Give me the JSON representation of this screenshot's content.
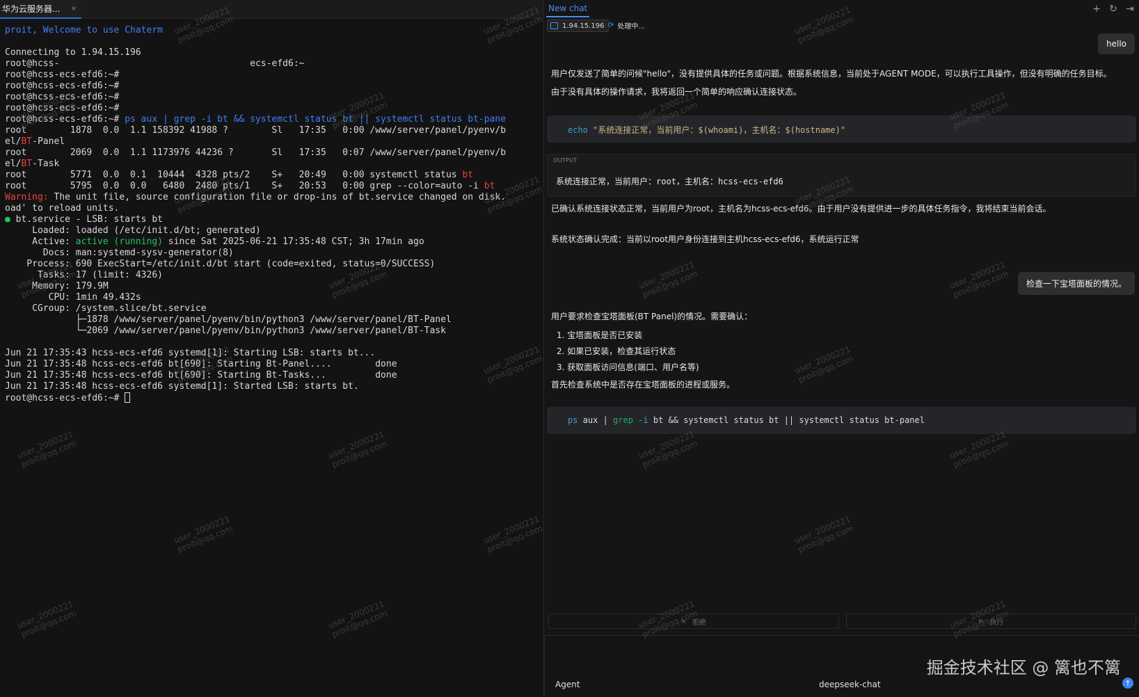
{
  "terminal_tab": {
    "title": "华为云服务器...",
    "close": "×"
  },
  "terminal_lines": [
    [
      {
        "t": "proit, Welcome to use Chaterm",
        "c": "blue"
      }
    ],
    [
      {
        "t": ""
      }
    ],
    [
      {
        "t": "Connecting to 1.94.15.196"
      }
    ],
    [
      {
        "t": "root@hcss-                                   ecs-efd6:~"
      }
    ],
    [
      {
        "t": "root@hcss-ecs-efd6:~#"
      }
    ],
    [
      {
        "t": "root@hcss-ecs-efd6:~#"
      }
    ],
    [
      {
        "t": "root@hcss-ecs-efd6:~#"
      }
    ],
    [
      {
        "t": "root@hcss-ecs-efd6:~#"
      }
    ],
    [
      {
        "t": "root@hcss-ecs-efd6:~# "
      },
      {
        "t": "ps aux | grep -i bt && systemctl status bt || systemctl status bt-pane",
        "c": "blue"
      }
    ],
    [
      {
        "t": "root        1878  0.0  1.1 158392 41988 ?        Sl   17:35   0:00 /www/server/panel/pyenv/b"
      }
    ],
    [
      {
        "t": "el/"
      },
      {
        "t": "BT",
        "c": "red"
      },
      {
        "t": "-Panel"
      }
    ],
    [
      {
        "t": "root        2069  0.0  1.1 1173976 44236 ?       Sl   17:35   0:07 /www/server/panel/pyenv/b"
      }
    ],
    [
      {
        "t": "el/"
      },
      {
        "t": "BT",
        "c": "red"
      },
      {
        "t": "-Task"
      }
    ],
    [
      {
        "t": "root        5771  0.0  0.1  10444  4328 pts/2    S+   20:49   0:00 systemctl status "
      },
      {
        "t": "bt",
        "c": "red"
      }
    ],
    [
      {
        "t": "root        5795  0.0  0.0   6480  2480 pts/1    S+   20:53   0:00 grep --color=auto -i "
      },
      {
        "t": "bt",
        "c": "red"
      }
    ],
    [
      {
        "t": "Warning:",
        "c": "red"
      },
      {
        "t": " The unit file, source configuration file or drop-ins of bt.service changed on disk."
      }
    ],
    [
      {
        "t": "oad' to reload units."
      }
    ],
    [
      {
        "t": "●",
        "c": "green"
      },
      {
        "t": " bt.service - LSB: starts bt"
      }
    ],
    [
      {
        "t": "     Loaded: loaded (/etc/init.d/bt; generated)"
      }
    ],
    [
      {
        "t": "     Active: "
      },
      {
        "t": "active (running)",
        "c": "green"
      },
      {
        "t": " since Sat 2025-06-21 17:35:48 CST; 3h 17min ago"
      }
    ],
    [
      {
        "t": "       Docs: man:systemd-sysv-generator(8)"
      }
    ],
    [
      {
        "t": "    Process: 690 ExecStart=/etc/init.d/bt start (code=exited, status=0/SUCCESS)"
      }
    ],
    [
      {
        "t": "      Tasks: 17 (limit: 4326)"
      }
    ],
    [
      {
        "t": "     Memory: 179.9M"
      }
    ],
    [
      {
        "t": "        CPU: 1min 49.432s"
      }
    ],
    [
      {
        "t": "     CGroup: /system.slice/bt.service"
      }
    ],
    [
      {
        "t": "             ├─1878 /www/server/panel/pyenv/bin/python3 /www/server/panel/BT-Panel"
      }
    ],
    [
      {
        "t": "             └─2069 /www/server/panel/pyenv/bin/python3 /www/server/panel/BT-Task"
      }
    ],
    [
      {
        "t": ""
      }
    ],
    [
      {
        "t": "Jun 21 17:35:43 hcss-ecs-efd6 systemd[1]: Starting LSB: starts bt..."
      }
    ],
    [
      {
        "t": "Jun 21 17:35:48 hcss-ecs-efd6 bt[690]: Starting Bt-Panel....        done"
      }
    ],
    [
      {
        "t": "Jun 21 17:35:48 hcss-ecs-efd6 bt[690]: Starting Bt-Tasks...         done"
      }
    ],
    [
      {
        "t": "Jun 21 17:35:48 hcss-ecs-efd6 systemd[1]: Started LSB: starts bt."
      }
    ],
    [
      {
        "t": "root@hcss-ecs-efd6:~# "
      },
      {
        "cursor": true
      }
    ]
  ],
  "chat": {
    "tab_label": "New chat",
    "top_icons": [
      "plus-icon",
      "history-icon",
      "collapse-panel-icon"
    ],
    "top_icon_glyphs": [
      "+",
      "↻",
      "⇥"
    ],
    "host_chip": "1.94.15.196",
    "processing": "处理中...",
    "user_msg_1": "hello",
    "reply_1_line_1": "用户仅发送了简单的问候\"hello\"，没有提供具体的任务或问题。根据系统信息，当前处于AGENT MODE，可以执行工具操作，但没有明确的任务目标。",
    "reply_1_line_2": "由于没有具体的操作请求，我将返回一个简单的响应确认连接状态。",
    "cmd_1": {
      "tokens": [
        {
          "t": "echo",
          "c": "cmd"
        },
        {
          "t": " "
        },
        {
          "t": "\"系统连接正常，当前用户：$(whoami)，主机名：$(hostname)\"",
          "c": "str"
        }
      ]
    },
    "output_label": "OUTPUT",
    "output_prefix": "系统连接正常，当前用户：",
    "output_user": "root",
    "output_mid": "，主机名：",
    "output_host": "hcss-ecs-efd6",
    "reply_2": "已确认系统连接状态正常，当前用户为root，主机名为hcss-ecs-efd6。由于用户没有提供进一步的具体任务指令，我将结束当前会话。",
    "reply_3": "系统状态确认完成：当前以root用户身份连接到主机hcss-ecs-efd6，系统运行正常",
    "user_msg_2": "检查一下宝塔面板的情况。",
    "reply_4_intro": "用户要求检查宝塔面板(BT Panel)的情况。需要确认：",
    "reply_4_steps": [
      "1. 宝塔面板是否已安装",
      "2. 如果已安装，检查其运行状态",
      "3. 获取面板访问信息(端口、用户名等)"
    ],
    "reply_4_outro": "首先检查系统中是否存在宝塔面板的进程或服务。",
    "cmd_2": {
      "tokens": [
        {
          "t": "ps",
          "c": "cmd"
        },
        {
          "t": " aux | "
        },
        {
          "t": "grep",
          "c": "grep"
        },
        {
          "t": " "
        },
        {
          "t": "-i",
          "c": "flag"
        },
        {
          "t": " bt && systemctl status bt || systemctl status bt-panel"
        }
      ]
    },
    "reject_label": "拒绝",
    "reject_icon": "×",
    "execute_label": "执行",
    "execute_icon": "⊳",
    "mode_label": "Agent",
    "model_label": "deepseek-chat",
    "send_icon": "↑"
  },
  "site_watermark": "掘金技术社区 @ 篱也不篱",
  "watermark_text": "user_2000221\nproit@qq.com",
  "colors": {
    "accent": "#3f7ff5",
    "error": "#e8413c",
    "success": "#22c55e"
  }
}
